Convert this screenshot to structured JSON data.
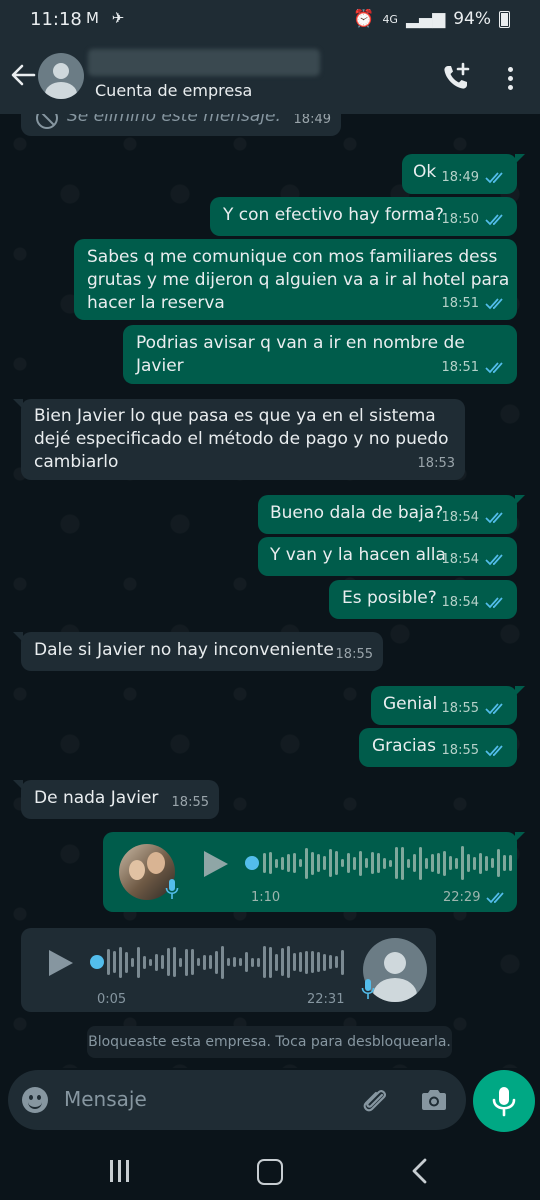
{
  "status_bar": {
    "time": "11:18",
    "notif_icons": "M ✈",
    "network": "4G",
    "battery": "94%"
  },
  "header": {
    "contact_name": "",
    "subtitle": "Cuenta de empresa"
  },
  "messages": [
    {
      "dir": "in",
      "text": "Se eliminó este mensaje.",
      "time": "18:49",
      "deleted": true
    },
    {
      "dir": "out",
      "text": "Ok",
      "time": "18:49"
    },
    {
      "dir": "out",
      "text": "Y con efectivo hay forma?",
      "time": "18:50"
    },
    {
      "dir": "out",
      "text": "Sabes q me comunique con mos familiares dess\ngrutas y me dijeron q alguien va a ir al hotel para\nhacer la reserva",
      "time": "18:51"
    },
    {
      "dir": "out",
      "text": "Podrias avisar q van a ir en nombre de Javier",
      "time": "18:51"
    },
    {
      "dir": "in",
      "text": "Bien Javier lo que pasa es que ya en el sistema\ndejé especificado el método de pago y no puedo\ncambiarlo",
      "time": "18:53"
    },
    {
      "dir": "out",
      "text": "Bueno dala de baja?",
      "time": "18:54"
    },
    {
      "dir": "out",
      "text": "Y van y la hacen alla",
      "time": "18:54"
    },
    {
      "dir": "out",
      "text": "Es posible?",
      "time": "18:54"
    },
    {
      "dir": "in",
      "text": "Dale si Javier no hay inconveniente",
      "time": "18:55"
    },
    {
      "dir": "out",
      "text": "Genial",
      "time": "18:55"
    },
    {
      "dir": "out",
      "text": "Gracias",
      "time": "18:55"
    },
    {
      "dir": "in",
      "text": "De nada Javier",
      "time": "18:55"
    }
  ],
  "voice_out": {
    "duration": "1:10",
    "time": "22:29"
  },
  "voice_in": {
    "duration": "0:05",
    "time": "22:31"
  },
  "system_message": "Bloqueaste esta empresa. Toca para desbloquearla.",
  "composer": {
    "placeholder": "Mensaje"
  },
  "colors": {
    "outgoing_bubble": "#005c4b",
    "incoming_bubble": "#1f2c34",
    "accent": "#00a884",
    "read_ticks": "#53bdeb"
  }
}
